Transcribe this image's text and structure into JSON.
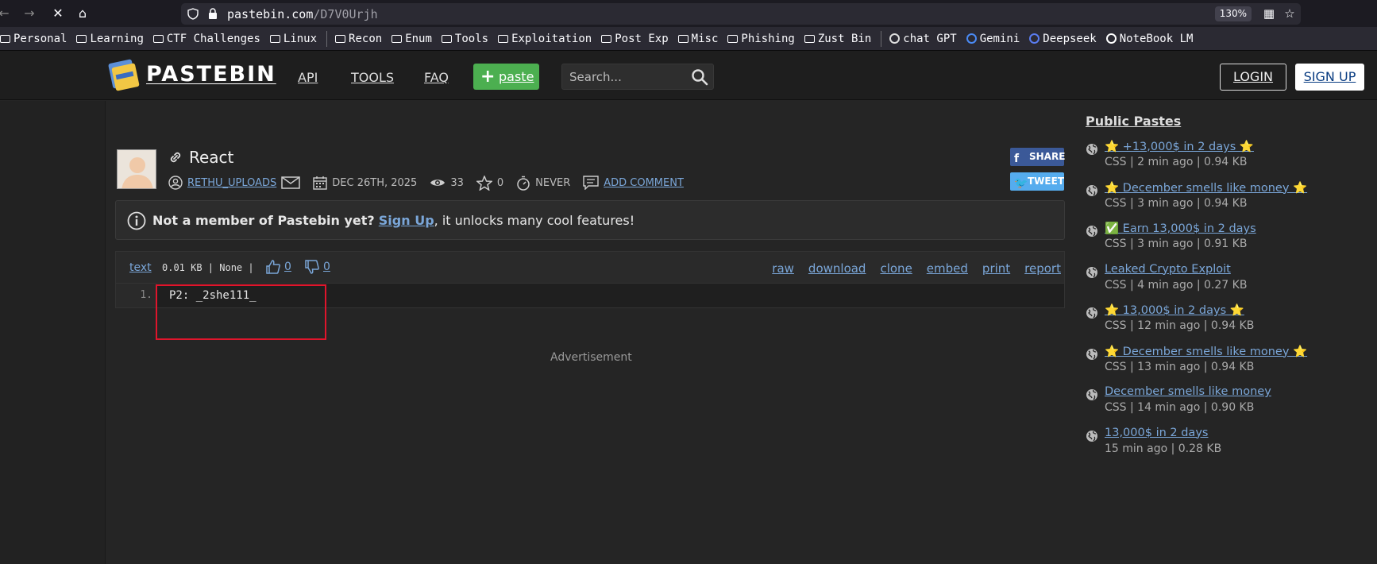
{
  "browser": {
    "url_domain": "pastebin.com",
    "url_path": "/D7V0Urjh",
    "zoom": "130%"
  },
  "bookmarks": [
    {
      "label": "Personal",
      "icon": "folder-icon"
    },
    {
      "label": "Learning",
      "icon": "folder-icon"
    },
    {
      "label": "CTF Challenges",
      "icon": "folder-icon"
    },
    {
      "label": "Linux",
      "icon": "folder-icon"
    },
    {
      "label": "Recon",
      "icon": "folder-icon"
    },
    {
      "label": "Enum",
      "icon": "folder-icon"
    },
    {
      "label": "Tools",
      "icon": "folder-icon"
    },
    {
      "label": "Exploitation",
      "icon": "folder-icon"
    },
    {
      "label": "Post Exp",
      "icon": "folder-icon"
    },
    {
      "label": "Misc",
      "icon": "folder-icon"
    },
    {
      "label": "Phishing",
      "icon": "folder-icon"
    },
    {
      "label": "Zust Bin",
      "icon": "folder-icon"
    },
    {
      "label": "chat GPT",
      "icon": "chatgpt-icon"
    },
    {
      "label": "Gemini",
      "icon": "gemini-icon"
    },
    {
      "label": "Deepseek",
      "icon": "deepseek-icon"
    },
    {
      "label": "NoteBook LM",
      "icon": "notebooklm-icon"
    }
  ],
  "header": {
    "logo_text": "PASTEBIN",
    "nav": [
      "API",
      "TOOLS",
      "FAQ"
    ],
    "paste_label": "paste",
    "search_placeholder": "Search...",
    "login_label": "LOGIN",
    "signup_label": "SIGN UP"
  },
  "paste": {
    "title": "React",
    "author": "RETHU_UPLOADS",
    "date": "DEC 26TH, 2025",
    "views": "33",
    "stars": "0",
    "expiry": "NEVER",
    "add_comment": "ADD COMMENT",
    "share_label": "SHARE",
    "tweet_label": "TWEET"
  },
  "notice": {
    "bold_text": "Not a member of Pastebin yet?",
    "link_text": "Sign Up",
    "rest_text": ", it unlocks many cool features!"
  },
  "code": {
    "format": "text",
    "size_info": "0.01 KB | None |",
    "likes": "0",
    "dislikes": "0",
    "actions": [
      "raw",
      "download",
      "clone",
      "embed",
      "print",
      "report"
    ],
    "line_number": "1.",
    "line_content": "P2: _2she111_"
  },
  "advertisement": "Advertisement",
  "sidebar": {
    "title": "Public Pastes",
    "items": [
      {
        "title": "⭐ +13,000$ in 2 days ⭐",
        "meta": "CSS | 2 min ago | 0.94 KB"
      },
      {
        "title": "⭐ December smells like money ⭐",
        "meta": "CSS | 3 min ago | 0.94 KB"
      },
      {
        "title": "✅ Earn 13,000$ in 2 days",
        "meta": "CSS | 3 min ago | 0.91 KB"
      },
      {
        "title": "Leaked Crypto Exploit",
        "meta": "CSS | 4 min ago | 0.27 KB"
      },
      {
        "title": "⭐ 13,000$ in 2 days ⭐",
        "meta": "CSS | 12 min ago | 0.94 KB"
      },
      {
        "title": "⭐ December smells like money ⭐",
        "meta": "CSS | 13 min ago | 0.94 KB"
      },
      {
        "title": "December smells like money",
        "meta": "CSS | 14 min ago | 0.90 KB"
      },
      {
        "title": "13,000$ in 2 days",
        "meta": "15 min ago | 0.28 KB"
      }
    ]
  }
}
